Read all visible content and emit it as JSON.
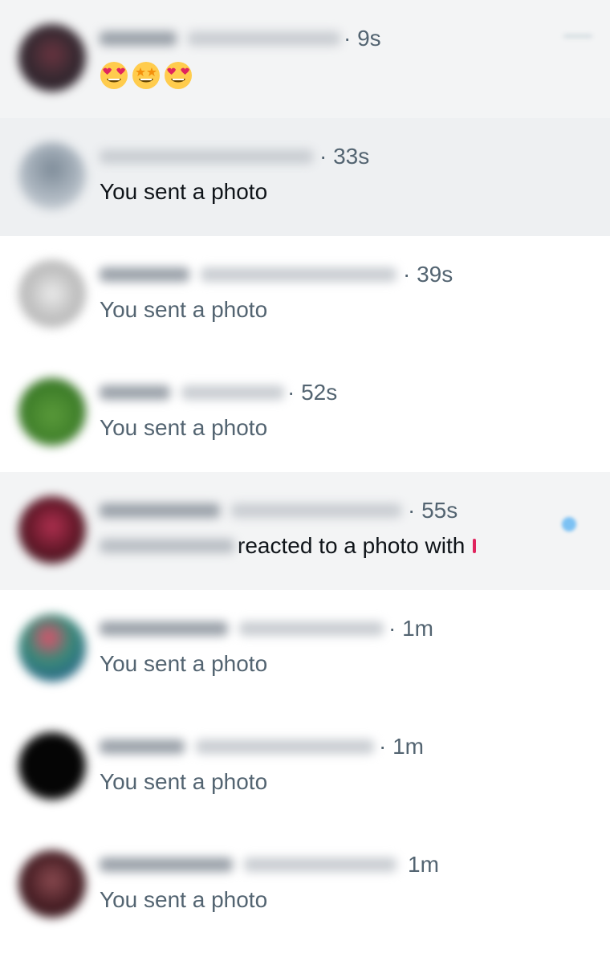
{
  "conversations": [
    {
      "time": "· 9s",
      "preview_emojis": [
        "heart-eyes",
        "star-struck",
        "heart-eyes"
      ],
      "avatar_color": "#3a2a32",
      "style": "shaded"
    },
    {
      "time": "· 33s",
      "preview": "You sent a photo",
      "avatar_color": "#9aa6b2",
      "style": "highlight"
    },
    {
      "time": "· 39s",
      "preview": "You sent a photo",
      "avatar_color": "#b9b9b9",
      "style": "plain"
    },
    {
      "time": "· 52s",
      "preview": "You sent a photo",
      "avatar_color": "#3f7f2a",
      "style": "plain"
    },
    {
      "time": "· 55s",
      "preview": "reacted to a photo with",
      "avatar_color": "#5a1a28",
      "style": "shaded",
      "unread": true
    },
    {
      "time": "· 1m",
      "preview": "You sent a photo",
      "avatar_color": "#3a8a78",
      "style": "plain"
    },
    {
      "time": "· 1m",
      "preview": "You sent a photo",
      "avatar_color": "#050505",
      "style": "plain"
    },
    {
      "time": "1m",
      "preview": "You sent a photo",
      "avatar_color": "#4a2026",
      "style": "plain"
    }
  ],
  "colors": {
    "secondary_text": "#536471",
    "primary_text": "#0f1419",
    "unread_dot": "#7cc1f3",
    "highlight_row": "#eef0f2"
  },
  "icons": {
    "more": "more-icon",
    "unread": "unread-dot"
  }
}
